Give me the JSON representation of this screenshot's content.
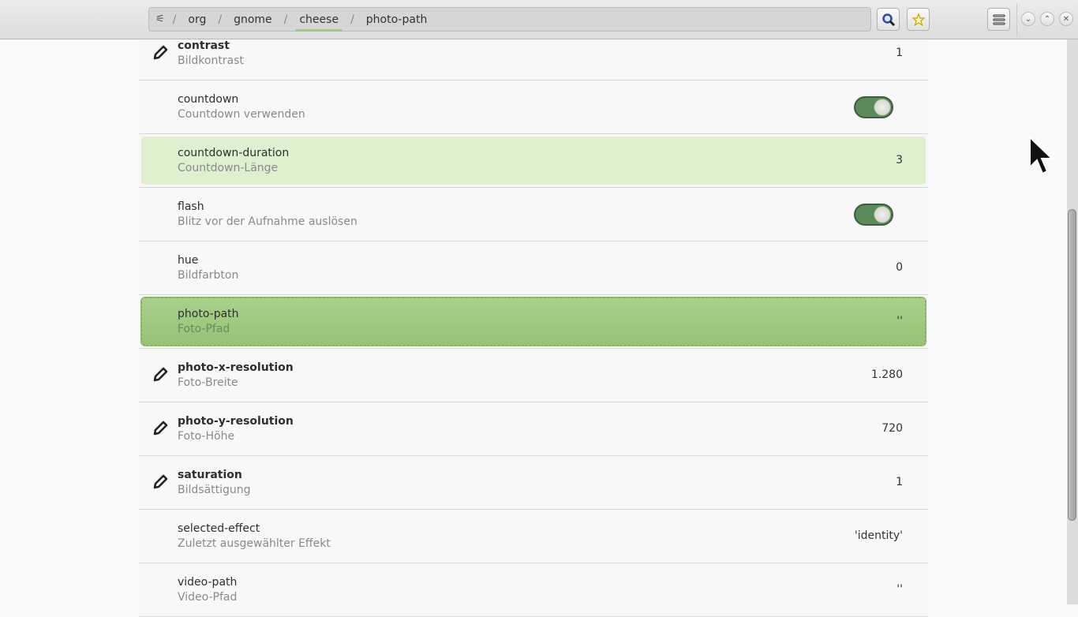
{
  "header": {
    "path": [
      "org",
      "gnome",
      "cheese",
      "photo-path"
    ],
    "active_crumb": 2
  },
  "rows": [
    {
      "name": "contrast",
      "desc": "Bildkontrast",
      "value": "1",
      "modified": true,
      "type": "value"
    },
    {
      "name": "countdown",
      "desc": "Countdown verwenden",
      "value": "",
      "modified": false,
      "type": "toggle"
    },
    {
      "name": "countdown-duration",
      "desc": "Countdown-Länge",
      "value": "3",
      "modified": false,
      "type": "value",
      "state": "hover"
    },
    {
      "name": "flash",
      "desc": "Blitz vor der Aufnahme auslösen",
      "value": "",
      "modified": false,
      "type": "toggle"
    },
    {
      "name": "hue",
      "desc": "Bildfarbton",
      "value": "0",
      "modified": false,
      "type": "value"
    },
    {
      "name": "photo-path",
      "desc": "Foto-Pfad",
      "value": "''",
      "modified": false,
      "type": "value",
      "state": "sel"
    },
    {
      "name": "photo-x-resolution",
      "desc": "Foto-Breite",
      "value": "1.280",
      "modified": true,
      "type": "value"
    },
    {
      "name": "photo-y-resolution",
      "desc": "Foto-Höhe",
      "value": "720",
      "modified": true,
      "type": "value"
    },
    {
      "name": "saturation",
      "desc": "Bildsättigung",
      "value": "1",
      "modified": true,
      "type": "value"
    },
    {
      "name": "selected-effect",
      "desc": "Zuletzt ausgewählter Effekt",
      "value": "'identity'",
      "modified": false,
      "type": "value"
    },
    {
      "name": "video-path",
      "desc": "Video-Pfad",
      "value": "''",
      "modified": false,
      "type": "value"
    }
  ],
  "scroll_position": 0.37
}
